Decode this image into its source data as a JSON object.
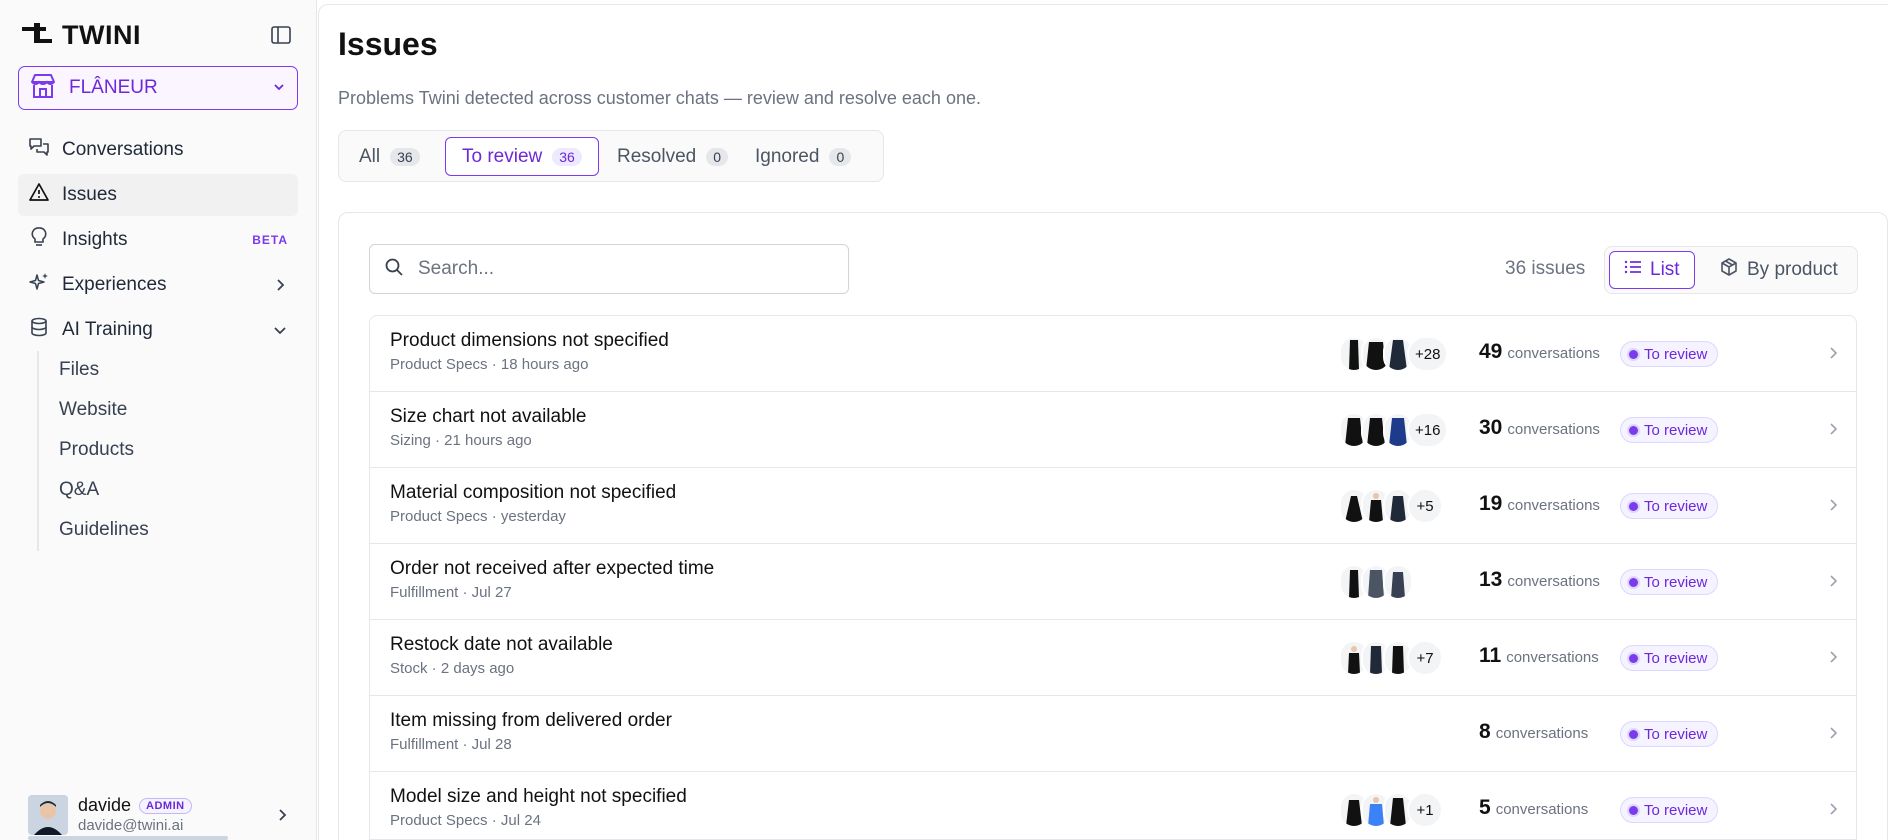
{
  "brand": {
    "name": "TWINI"
  },
  "store": {
    "name": "FLÂNEUR"
  },
  "nav": {
    "conversations": "Conversations",
    "issues": "Issues",
    "insights": "Insights",
    "insights_badge": "BETA",
    "experiences": "Experiences",
    "ai_training": "AI Training"
  },
  "subnav": [
    "Files",
    "Website",
    "Products",
    "Q&A",
    "Guidelines"
  ],
  "user": {
    "name": "davide",
    "role": "ADMIN",
    "email": "davide@twini.ai"
  },
  "page": {
    "title": "Issues",
    "subtitle": "Problems Twini detected across customer chats — review and resolve each one."
  },
  "tabs": [
    {
      "label": "All",
      "count": "36"
    },
    {
      "label": "To review",
      "count": "36"
    },
    {
      "label": "Resolved",
      "count": "0"
    },
    {
      "label": "Ignored",
      "count": "0"
    }
  ],
  "search": {
    "placeholder": "Search..."
  },
  "summary": {
    "issues_count": "36 issues"
  },
  "view": {
    "list": "List",
    "by_product": "By product"
  },
  "issues": [
    {
      "title": "Product dimensions not specified",
      "meta": "Product Specs · 18 hours ago",
      "more": "+28",
      "count": "49",
      "count_label": "conversations",
      "status": "To review"
    },
    {
      "title": "Size chart not available",
      "meta": "Sizing · 21 hours ago",
      "more": "+16",
      "count": "30",
      "count_label": "conversations",
      "status": "To review"
    },
    {
      "title": "Material composition not specified",
      "meta": "Product Specs · yesterday",
      "more": "+5",
      "count": "19",
      "count_label": "conversations",
      "status": "To review"
    },
    {
      "title": "Order not received after expected time",
      "meta": "Fulfillment · Jul 27",
      "more": "",
      "count": "13",
      "count_label": "conversations",
      "status": "To review"
    },
    {
      "title": "Restock date not available",
      "meta": "Stock · 2 days ago",
      "more": "+7",
      "count": "11",
      "count_label": "conversations",
      "status": "To review"
    },
    {
      "title": "Item missing from delivered order",
      "meta": "Fulfillment · Jul 28",
      "more": "",
      "count": "8",
      "count_label": "conversations",
      "status": "To review"
    },
    {
      "title": "Model size and height not specified",
      "meta": "Product Specs · Jul 24",
      "more": "+1",
      "count": "5",
      "count_label": "conversations",
      "status": "To review"
    }
  ],
  "colors": {
    "accent": "#7c3aed",
    "accent_bg": "#f5f3ff",
    "status_border": "#ddd6fe"
  }
}
